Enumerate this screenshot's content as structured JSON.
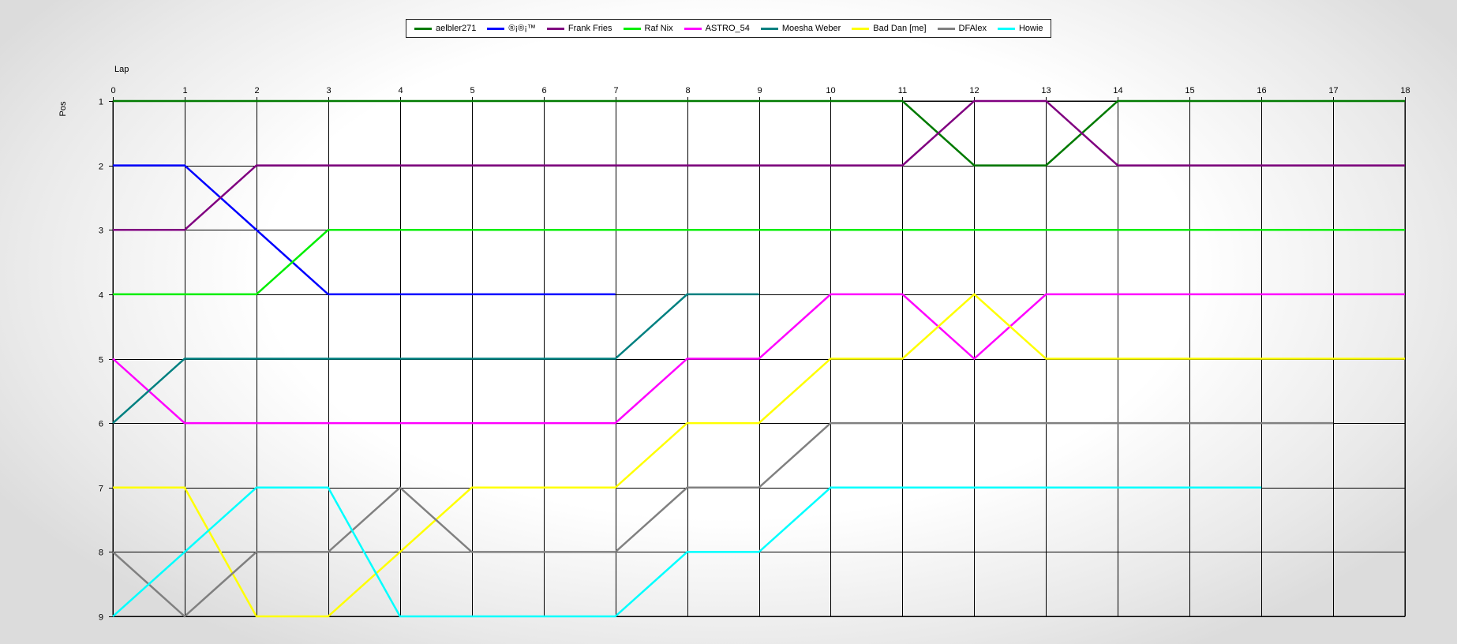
{
  "chart_data": {
    "type": "line",
    "title": "",
    "xlabel": "Lap",
    "ylabel": "Pos",
    "xlim": [
      0,
      18
    ],
    "ylim": [
      1,
      9
    ],
    "y_inverted": true,
    "grid": true,
    "legend_position": "top-center",
    "x_ticks": [
      0,
      1,
      2,
      3,
      4,
      5,
      6,
      7,
      8,
      9,
      10,
      11,
      12,
      13,
      14,
      15,
      16,
      17,
      18
    ],
    "y_ticks": [
      1,
      2,
      3,
      4,
      5,
      6,
      7,
      8,
      9
    ],
    "series": [
      {
        "name": "aelbler271",
        "color": "#007a00",
        "x": [
          0,
          1,
          2,
          3,
          4,
          5,
          6,
          7,
          8,
          9,
          10,
          11,
          12,
          13,
          14,
          15,
          16,
          17,
          18
        ],
        "y": [
          1,
          1,
          1,
          1,
          1,
          1,
          1,
          1,
          1,
          1,
          1,
          1,
          2,
          2,
          1,
          1,
          1,
          1,
          1
        ]
      },
      {
        "name": "®¡®¡™",
        "color": "#0000ff",
        "x": [
          0,
          1,
          2,
          3,
          4,
          5,
          6,
          7
        ],
        "y": [
          2,
          2,
          3,
          4,
          4,
          4,
          4,
          4
        ]
      },
      {
        "name": "Frank Fries",
        "color": "#800080",
        "x": [
          0,
          1,
          2,
          3,
          4,
          5,
          6,
          7,
          8,
          9,
          10,
          11,
          12,
          13,
          14,
          15,
          16,
          17,
          18
        ],
        "y": [
          3,
          3,
          2,
          2,
          2,
          2,
          2,
          2,
          2,
          2,
          2,
          2,
          1,
          1,
          2,
          2,
          2,
          2,
          2
        ]
      },
      {
        "name": "Raf Nix",
        "color": "#00ee00",
        "x": [
          0,
          1,
          2,
          3,
          4,
          5,
          6,
          7,
          8,
          9,
          10,
          11,
          12,
          13,
          14,
          15,
          16,
          17,
          18
        ],
        "y": [
          4,
          4,
          4,
          3,
          3,
          3,
          3,
          3,
          3,
          3,
          3,
          3,
          3,
          3,
          3,
          3,
          3,
          3,
          3
        ]
      },
      {
        "name": "ASTRO_54",
        "color": "#ff00ff",
        "x": [
          0,
          1,
          2,
          3,
          4,
          5,
          6,
          7,
          8,
          9,
          10,
          11,
          12,
          13,
          14,
          15,
          16,
          17,
          18
        ],
        "y": [
          5,
          6,
          6,
          6,
          6,
          6,
          6,
          6,
          5,
          5,
          4,
          4,
          5,
          4,
          4,
          4,
          4,
          4,
          4
        ]
      },
      {
        "name": "Moesha Weber",
        "color": "#008080",
        "x": [
          0,
          1,
          2,
          3,
          4,
          5,
          6,
          7,
          8,
          9
        ],
        "y": [
          6,
          5,
          5,
          5,
          5,
          5,
          5,
          5,
          4,
          4
        ]
      },
      {
        "name": "Bad Dan [me]",
        "color": "#ffff00",
        "x": [
          0,
          1,
          2,
          3,
          4,
          5,
          6,
          7,
          8,
          9,
          10,
          11,
          12,
          13,
          14,
          15,
          16,
          17,
          18
        ],
        "y": [
          7,
          7,
          9,
          9,
          8,
          7,
          7,
          7,
          6,
          6,
          5,
          5,
          4,
          5,
          5,
          5,
          5,
          5,
          5
        ]
      },
      {
        "name": "DFAlex",
        "color": "#808080",
        "x": [
          0,
          1,
          2,
          3,
          4,
          5,
          6,
          7,
          8,
          9,
          10,
          11,
          12,
          13,
          14,
          15,
          16,
          17
        ],
        "y": [
          8,
          9,
          8,
          8,
          7,
          8,
          8,
          8,
          7,
          7,
          6,
          6,
          6,
          6,
          6,
          6,
          6,
          6
        ]
      },
      {
        "name": "Howie",
        "color": "#00ffff",
        "x": [
          0,
          1,
          2,
          3,
          4,
          5,
          6,
          7,
          8,
          9,
          10,
          11,
          12,
          13,
          14,
          15,
          16
        ],
        "y": [
          9,
          8,
          7,
          7,
          9,
          9,
          9,
          9,
          8,
          8,
          7,
          7,
          7,
          7,
          7,
          7,
          7
        ]
      }
    ]
  }
}
